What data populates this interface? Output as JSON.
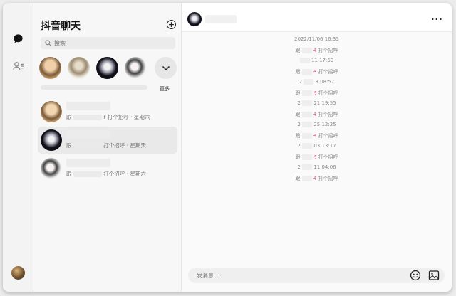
{
  "window": {
    "title": ""
  },
  "sidebar": {
    "icons": [
      "chat-bubble-icon",
      "contacts-icon"
    ],
    "user_avatar": "user-avatar"
  },
  "chat_list": {
    "title": "抖音聊天",
    "search_placeholder": "搜索",
    "more_label": "更多",
    "items": [
      {
        "preview_prefix": "跟",
        "preview_suffix": "r 打个招呼 · 星期六"
      },
      {
        "preview_prefix": "跟",
        "preview_suffix": "打个招呼 · 星期天"
      },
      {
        "preview_prefix": "跟",
        "preview_suffix": "打个招呼 · 星期六"
      }
    ]
  },
  "conversation": {
    "menu_label": "···",
    "header_timestamp": "2022/11/06 16:33",
    "entries": [
      {
        "left": "跟",
        "right": "打个招呼"
      },
      {
        "left": "",
        "right": "11 17:59"
      },
      {
        "left": "跟",
        "right": "打个招呼"
      },
      {
        "left": "2",
        "right": "8 08:57"
      },
      {
        "left": "跟",
        "right": "打个招呼"
      },
      {
        "left": "2",
        "right": "21 19:55"
      },
      {
        "left": "跟",
        "right": "打个招呼"
      },
      {
        "left": "2",
        "right": "25 12:25"
      },
      {
        "left": "跟",
        "right": "打个招呼"
      },
      {
        "left": "2",
        "right": "03 13:17"
      },
      {
        "left": "跟",
        "right": "打个招呼"
      },
      {
        "left": "2",
        "right": "11 04:06"
      },
      {
        "left": "跟",
        "right": "打个招呼"
      }
    ],
    "input_placeholder": "发消息..."
  }
}
